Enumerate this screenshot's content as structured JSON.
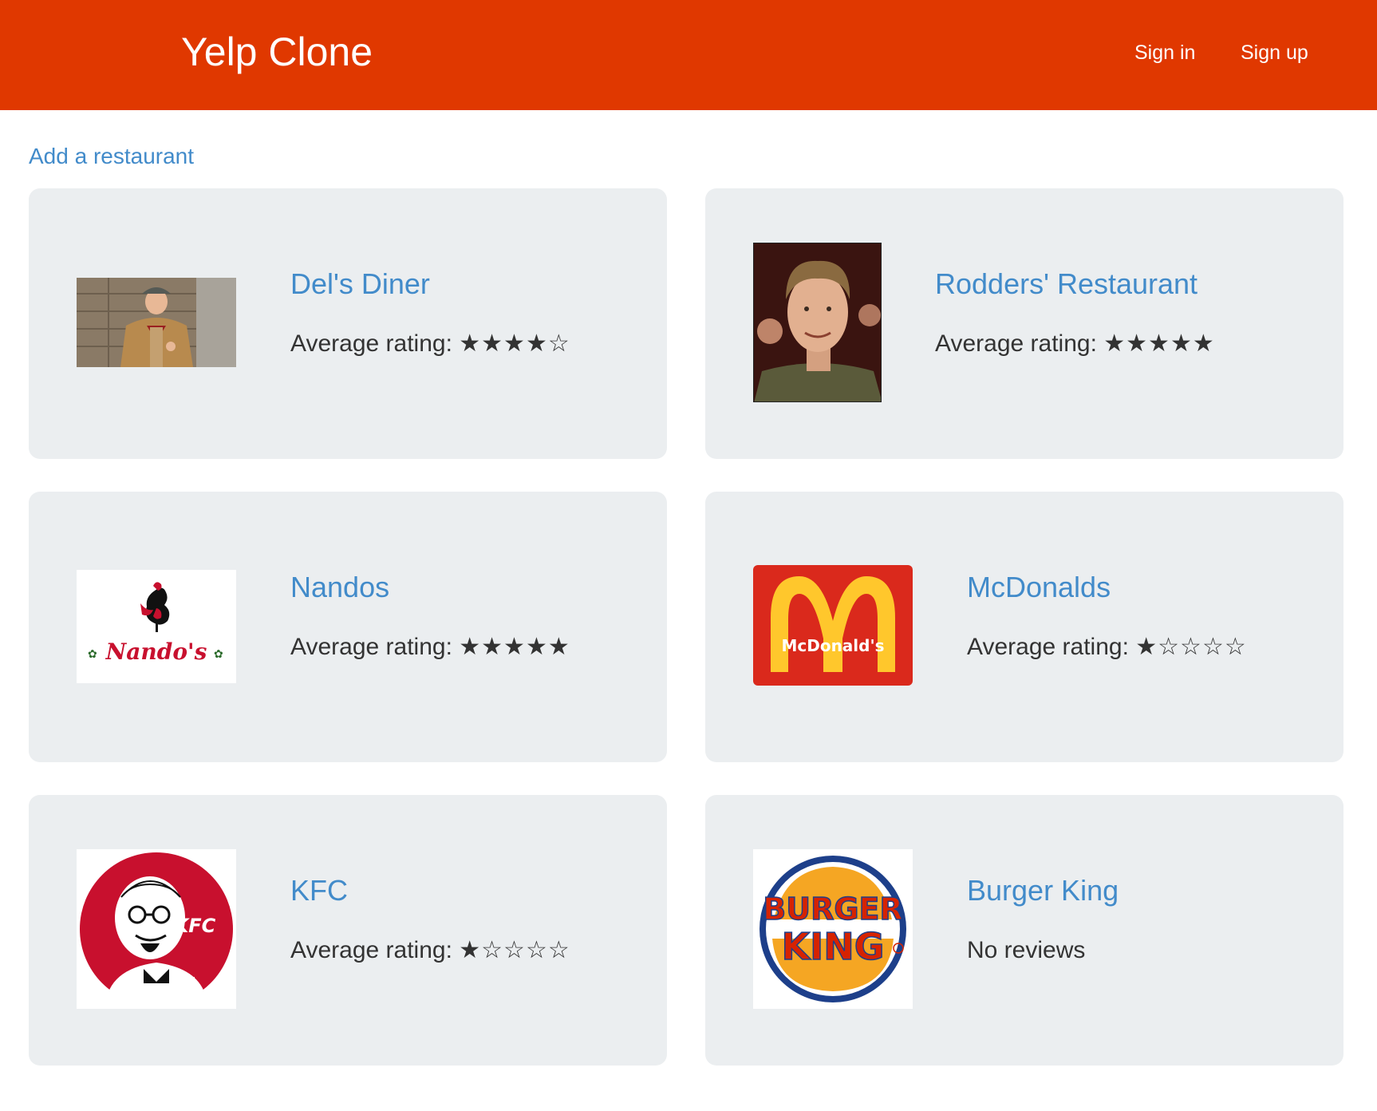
{
  "header": {
    "brand": "Yelp Clone",
    "nav": {
      "sign_in": "Sign in",
      "sign_up": "Sign up"
    },
    "background_color": "#e03800"
  },
  "main": {
    "add_link": "Add a restaurant",
    "link_color": "#428bca",
    "restaurants": [
      {
        "name": "Del's Diner",
        "rating_label": "Average rating:",
        "stars": "★★★★☆",
        "rating": 4
      },
      {
        "name": "Rodders' Restaurant",
        "rating_label": "Average rating:",
        "stars": "★★★★★",
        "rating": 5
      },
      {
        "name": "Nandos",
        "rating_label": "Average rating:",
        "stars": "★★★★★",
        "rating": 5,
        "logo_text": "Nando's"
      },
      {
        "name": "McDonalds",
        "rating_label": "Average rating:",
        "stars": "★☆☆☆☆",
        "rating": 1,
        "logo_text": "McDonald's"
      },
      {
        "name": "KFC",
        "rating_label": "Average rating:",
        "stars": "★☆☆☆☆",
        "rating": 1,
        "logo_text": "KFC"
      },
      {
        "name": "Burger King",
        "no_reviews": "No reviews",
        "logo_text_1": "BURGER",
        "logo_text_2": "KING"
      }
    ]
  }
}
